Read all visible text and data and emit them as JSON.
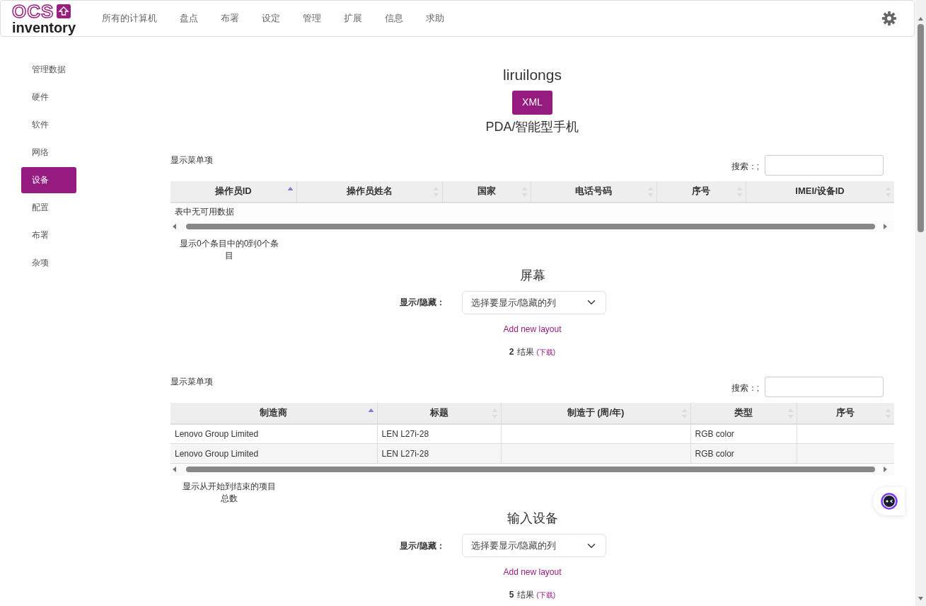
{
  "navbar": {
    "logo": {
      "top": "OCS",
      "bottom": "inventory"
    },
    "menu": [
      {
        "label": "所有的计算机"
      },
      {
        "label": "盘点"
      },
      {
        "label": "布署"
      },
      {
        "label": "设定"
      },
      {
        "label": "管理"
      },
      {
        "label": "扩展"
      },
      {
        "label": "信息"
      },
      {
        "label": "求助"
      }
    ]
  },
  "sidebar": {
    "items": [
      {
        "label": "管理数据",
        "selected": false
      },
      {
        "label": "硬件",
        "selected": false
      },
      {
        "label": "软件",
        "selected": false
      },
      {
        "label": "网络",
        "selected": false
      },
      {
        "label": "设备",
        "selected": true
      },
      {
        "label": "配置",
        "selected": false
      },
      {
        "label": "布署",
        "selected": false
      },
      {
        "label": "杂项",
        "selected": false
      }
    ]
  },
  "page": {
    "title": "liruilongs",
    "xml_button": "XML",
    "sections": [
      {
        "heading": "PDA/智能型手机",
        "table": {
          "length_label": "显示菜单项",
          "search_label": "搜索：;",
          "columns": [
            {
              "label": "操作员ID",
              "sorted": true
            },
            {
              "label": "操作员姓名",
              "sorted": false
            },
            {
              "label": "国家",
              "sorted": false
            },
            {
              "label": "电话号码",
              "sorted": false
            },
            {
              "label": "序号",
              "sorted": false
            },
            {
              "label": "IMEI/设备ID",
              "sorted": false
            }
          ],
          "empty_message": "表中无可用数据",
          "info": "显示0个条目中的0到0个条目"
        }
      },
      {
        "heading": "屏幕",
        "column_toggle": {
          "label": "显示/隐藏：",
          "value": "选择要显示/隐藏的列"
        },
        "add_layout": "Add new layout",
        "results": {
          "count": "2",
          "label": "结果",
          "download": "(下载)"
        },
        "table": {
          "length_label": "显示菜单项",
          "search_label": "搜索：;",
          "columns": [
            {
              "label": "制造商",
              "sorted": true
            },
            {
              "label": "标题",
              "sorted": false
            },
            {
              "label": "制造于 (周/年)",
              "sorted": false
            },
            {
              "label": "类型",
              "sorted": false
            },
            {
              "label": "序号",
              "sorted": false
            }
          ],
          "rows": [
            [
              "Lenovo Group Limited",
              "LEN L27i-28",
              null,
              "RGB color",
              null
            ],
            [
              "Lenovo Group Limited",
              "LEN L27i-28",
              null,
              "RGB color",
              null
            ]
          ],
          "info": "显示从开始到结束的项目总数"
        }
      },
      {
        "heading": "输入设备",
        "column_toggle": {
          "label": "显示/隐藏：",
          "value": "选择要显示/隐藏的列"
        },
        "add_layout": "Add new layout",
        "results": {
          "count": "5",
          "label": "结果",
          "download": "(下载)"
        }
      }
    ]
  }
}
